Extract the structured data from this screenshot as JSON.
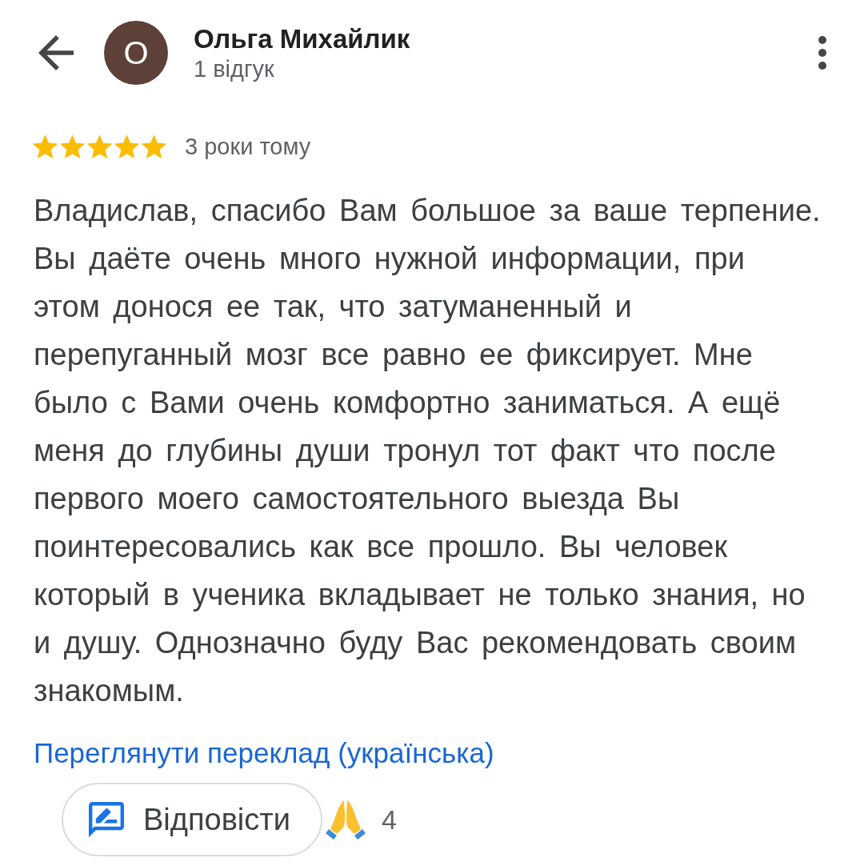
{
  "reviewer": {
    "avatar_letter": "О",
    "name": "Ольга Михайлик",
    "review_count": "1 відгук"
  },
  "review": {
    "stars": 5,
    "time": "3 роки тому",
    "text": "Владислав, спасибо Вам большое за ваше терпение. Вы даёте очень много нужной информации, при этом донося ее так, что затуманенный и перепуганный мозг все равно ее фиксирует. Мне было с Вами очень комфортно заниматься. А ещё меня до глубины души тронул тот факт что после первого моего самостоятельного выезда Вы поинтересовались как все прошло. Вы человек который в ученика вкладывает не только знания, но и душу. Однозначно буду Вас рекомендовать своим знакомым.",
    "translate_link": "Переглянути переклад (українська)"
  },
  "actions": {
    "reply_button": "Відповісти",
    "reaction_count": "4"
  }
}
